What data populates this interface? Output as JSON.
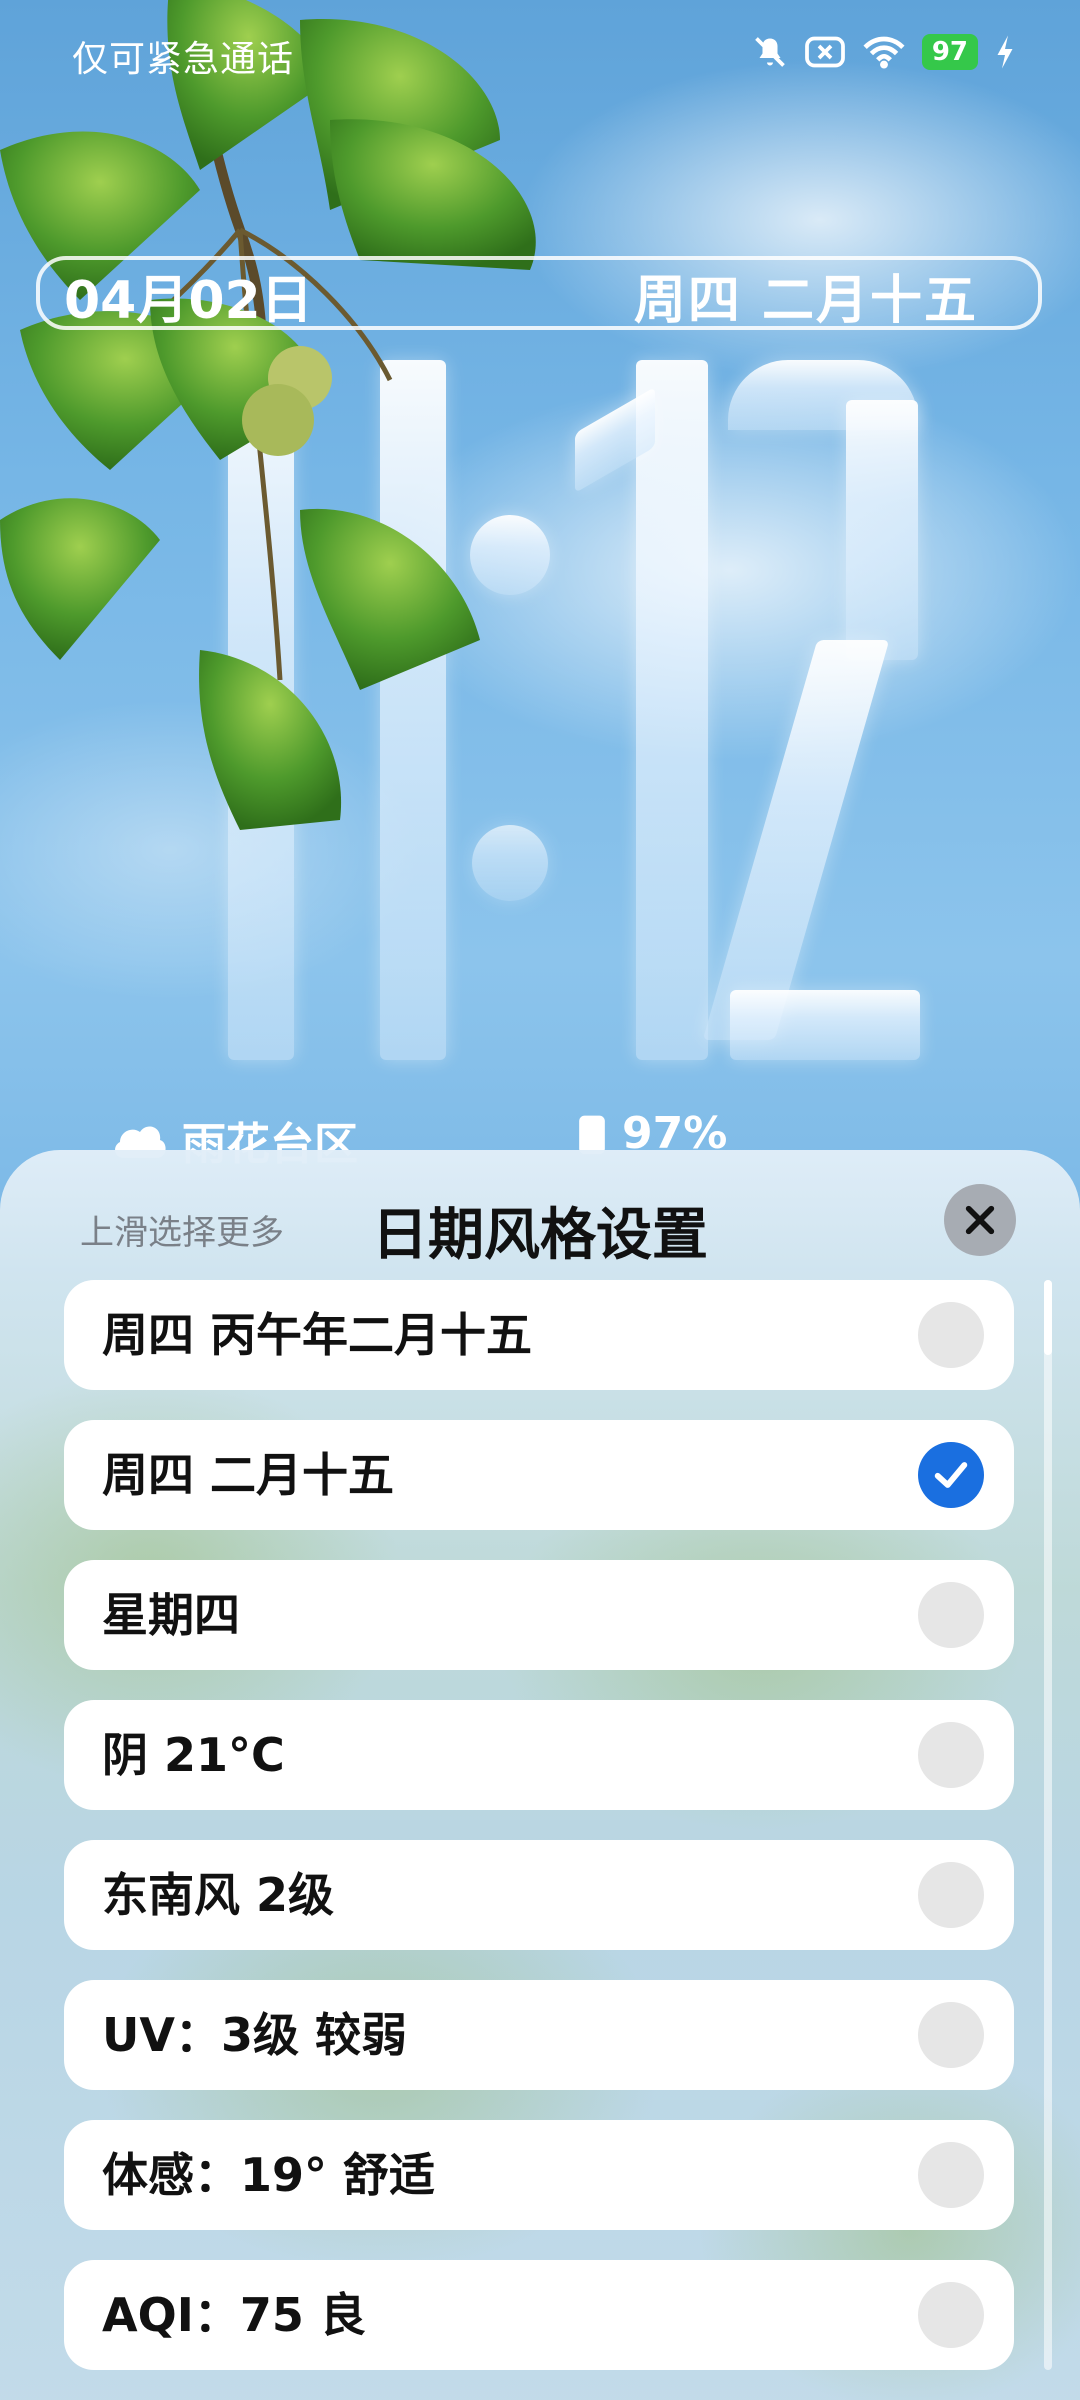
{
  "status_bar": {
    "carrier_text": "仅可紧急通话",
    "icons": [
      "mute-bell-icon",
      "sim-off-icon",
      "wifi-icon",
      "battery-icon",
      "charging-bolt-icon"
    ],
    "battery_level": "97"
  },
  "lockscreen": {
    "date": "04月02日",
    "weekday_lunar": "周四  二月十五",
    "time_hours": "11",
    "time_minutes": "12",
    "location_icon": "cloud-icon",
    "location": "雨花台区",
    "battery_icon": "battery-icon",
    "battery_percent": "97%"
  },
  "sheet": {
    "hint": "上滑选择更多",
    "title": "日期风格设置",
    "close_icon": "close-icon",
    "options": [
      {
        "label": "周四  丙午年二月十五",
        "selected": false
      },
      {
        "label": "周四  二月十五",
        "selected": true
      },
      {
        "label": "星期四",
        "selected": false
      },
      {
        "label": "阴 21°C",
        "selected": false
      },
      {
        "label": "东南风 2级",
        "selected": false
      },
      {
        "label": "UV：3级 较弱",
        "selected": false
      },
      {
        "label": "体感：19° 舒适",
        "selected": false
      },
      {
        "label": "AQI：75 良",
        "selected": false
      }
    ]
  },
  "colors": {
    "accent": "#1a6fe0",
    "battery_badge": "#35c84a",
    "sky": "#6fb0e2"
  }
}
